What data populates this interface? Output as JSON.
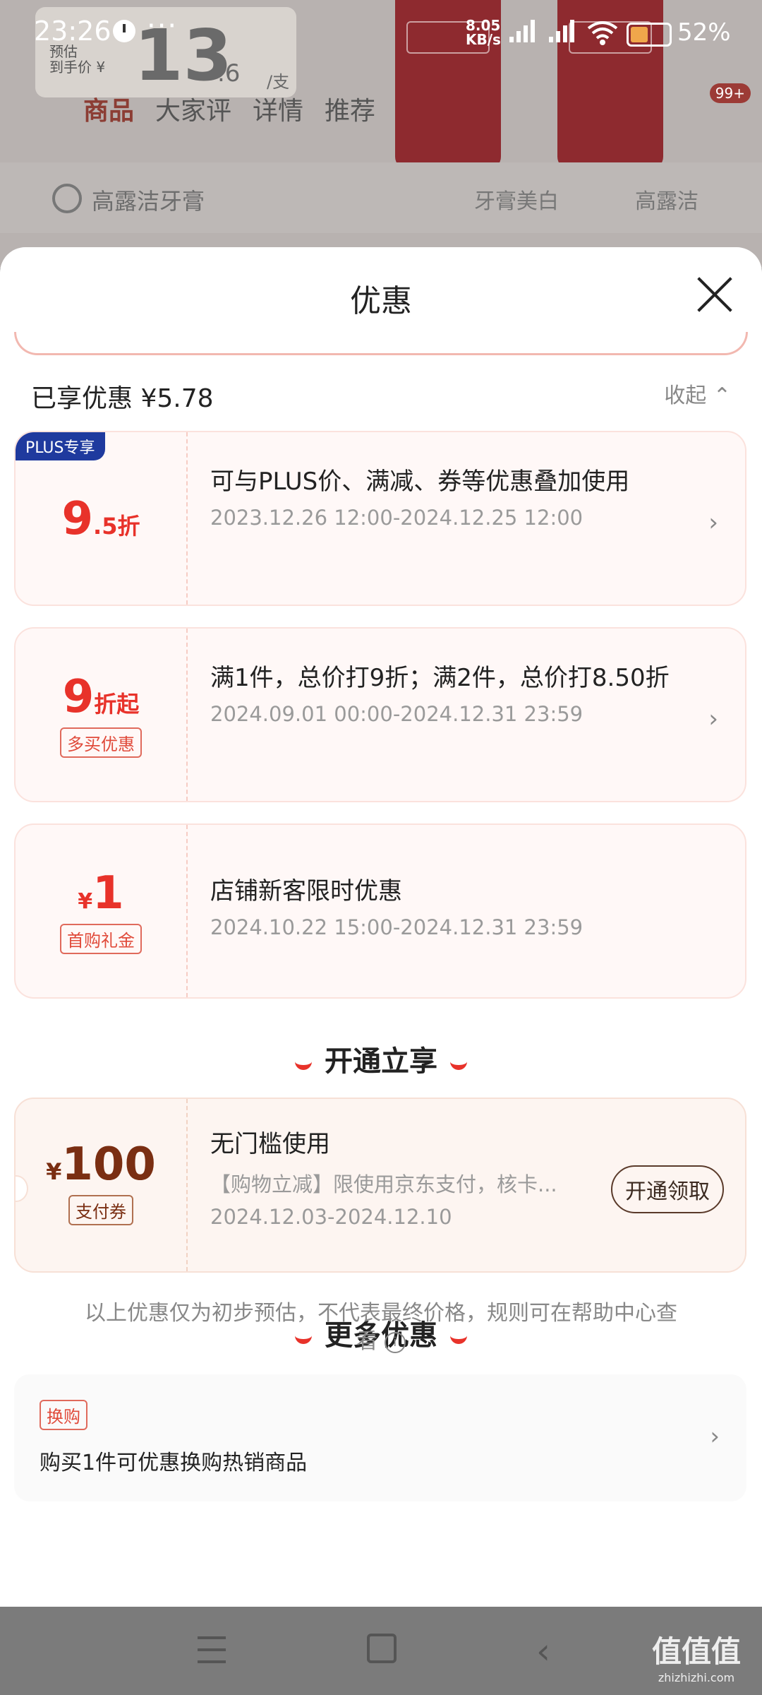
{
  "status_bar": {
    "time": "23:26",
    "dots": "···",
    "net_speed_value": "8.05",
    "net_speed_unit": "KB/s",
    "battery": "52%",
    "battery_level": 0.52
  },
  "background_page": {
    "price_prefix_1": "预估",
    "price_prefix_2": "到手价 ¥",
    "price_int": "13",
    "price_dec": ".6",
    "price_unit": "/支",
    "tabs": [
      "商品",
      "大家评",
      "详情",
      "推荐"
    ],
    "badge": "99+",
    "search_text": "高露洁牙膏",
    "chip1": "牙膏美白",
    "chip2": "高露洁"
  },
  "sheet": {
    "title": "优惠",
    "saved_label": "已享优惠 ¥5.78",
    "collapse_label": "收起 ⌃",
    "offers": [
      {
        "tag": "PLUS专享",
        "value_big": "9",
        "value_small": ".5折",
        "desc": "可与PLUS价、满减、券等优惠叠加使用",
        "date": "2023.12.26 12:00-2024.12.25 12:00"
      },
      {
        "value_big": "9",
        "value_small": "折起",
        "badge": "多买优惠",
        "desc": "满1件，总价打9折；满2件，总价打8.50折",
        "date": "2024.09.01 00:00-2024.12.31 23:59"
      },
      {
        "value_currency": "¥",
        "value_big": "1",
        "badge": "首购礼金",
        "desc": "店铺新客限时优惠",
        "date": "2024.10.22 15:00-2024.12.31 23:59"
      }
    ],
    "section_open": "开通立享",
    "pay_offer": {
      "currency": "¥",
      "amount": "100",
      "badge": "支付券",
      "title": "无门槛使用",
      "desc": "【购物立减】限使用京东支付，核卡...",
      "date": "2024.12.03-2024.12.10",
      "button": "开通领取"
    },
    "section_more": "更多优惠",
    "swap": {
      "tag": "换购",
      "text": "购买1件可优惠换购热销商品"
    },
    "disclaimer": "以上优惠仅为初步预估，不代表最终价格，规则可在帮助中心查看",
    "info_glyph": "i"
  },
  "watermark": {
    "main": "值值值",
    "sub": "zhizhizhi.com"
  },
  "colors": {
    "accent_red": "#e8322a",
    "plus_blue": "#1f3a9e",
    "overlay_grey": "#7d7d7d"
  }
}
